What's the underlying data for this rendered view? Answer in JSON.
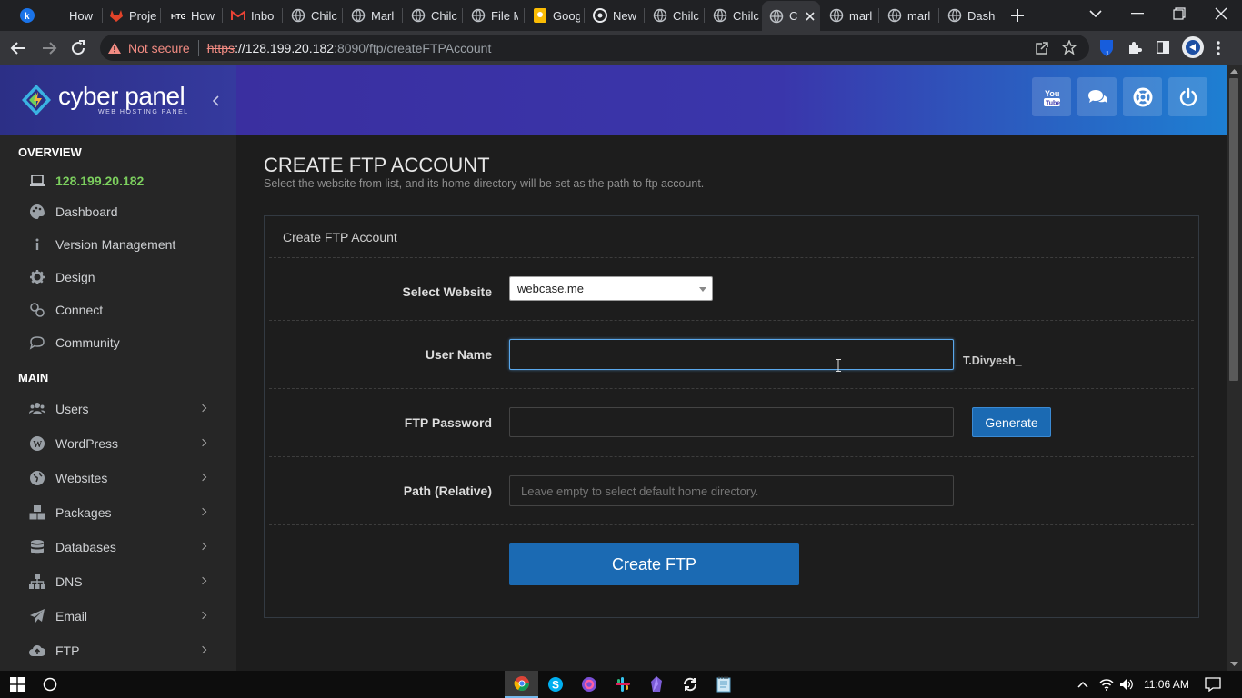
{
  "browser": {
    "tabs": [
      {
        "title": "How",
        "icon": "k-app-icon"
      },
      {
        "title": "How",
        "icon": "globe-icon"
      },
      {
        "title": "Proje",
        "icon": "gitlab-icon"
      },
      {
        "title": "How",
        "icon": "htg-icon"
      },
      {
        "title": "Inbo",
        "icon": "gmail-icon"
      },
      {
        "title": "Chilc",
        "icon": "globe-icon"
      },
      {
        "title": "Marl",
        "icon": "globe-icon"
      },
      {
        "title": "Chilc",
        "icon": "globe-icon"
      },
      {
        "title": "File M",
        "icon": "globe-icon"
      },
      {
        "title": "Goog",
        "icon": "google-keep-icon"
      },
      {
        "title": "New",
        "icon": "chrome-icon"
      },
      {
        "title": "Chilc",
        "icon": "globe-icon"
      },
      {
        "title": "Chilc",
        "icon": "globe-icon"
      },
      {
        "title": "C",
        "icon": "globe-icon"
      },
      {
        "title": "marl",
        "icon": "globe-icon"
      },
      {
        "title": "marl",
        "icon": "globe-icon"
      },
      {
        "title": "Dash",
        "icon": "globe-icon"
      }
    ],
    "security_label": "Not secure",
    "url_scheme": "https",
    "url_host": "://128.199.20.182",
    "url_rest": ":8090/ftp/createFTPAccount"
  },
  "app": {
    "logo_text": "cyber panel",
    "logo_sub": "WEB HOSTING PANEL"
  },
  "sidebar": {
    "overview_title": "OVERVIEW",
    "overview_items": [
      {
        "label": "128.199.20.182",
        "icon": "laptop-icon"
      },
      {
        "label": "Dashboard",
        "icon": "palette-icon"
      },
      {
        "label": "Version Management",
        "icon": "info-icon"
      },
      {
        "label": "Design",
        "icon": "gear-icon"
      },
      {
        "label": "Connect",
        "icon": "link-icon"
      },
      {
        "label": "Community",
        "icon": "chat-icon"
      }
    ],
    "main_title": "MAIN",
    "main_items": [
      {
        "label": "Users",
        "icon": "users-icon"
      },
      {
        "label": "WordPress",
        "icon": "wordpress-icon"
      },
      {
        "label": "Websites",
        "icon": "globe-icon"
      },
      {
        "label": "Packages",
        "icon": "cubes-icon"
      },
      {
        "label": "Databases",
        "icon": "database-icon"
      },
      {
        "label": "DNS",
        "icon": "sitemap-icon"
      },
      {
        "label": "Email",
        "icon": "paper-plane-icon"
      },
      {
        "label": "FTP",
        "icon": "cloud-upload-icon"
      }
    ]
  },
  "page": {
    "title": "CREATE FTP ACCOUNT",
    "subtitle": "Select the website from list, and its home directory will be set as the path to ftp account.",
    "panel_title": "Create FTP Account",
    "fields": {
      "website_label": "Select Website",
      "website_value": "webcase.me",
      "username_label": "User Name",
      "username_value": "",
      "username_suffix": "T.Divyesh_",
      "password_label": "FTP Password",
      "password_value": "",
      "generate_label": "Generate",
      "path_label": "Path (Relative)",
      "path_placeholder": "Leave empty to select default home directory."
    },
    "submit_label": "Create FTP"
  },
  "taskbar": {
    "time": "11:06 AM"
  },
  "colors": {
    "accent_green": "#7ccf5e",
    "button_blue": "#1b6ab3",
    "header_purple": "#3a2fa0",
    "header_blue": "#1e7fd2"
  }
}
